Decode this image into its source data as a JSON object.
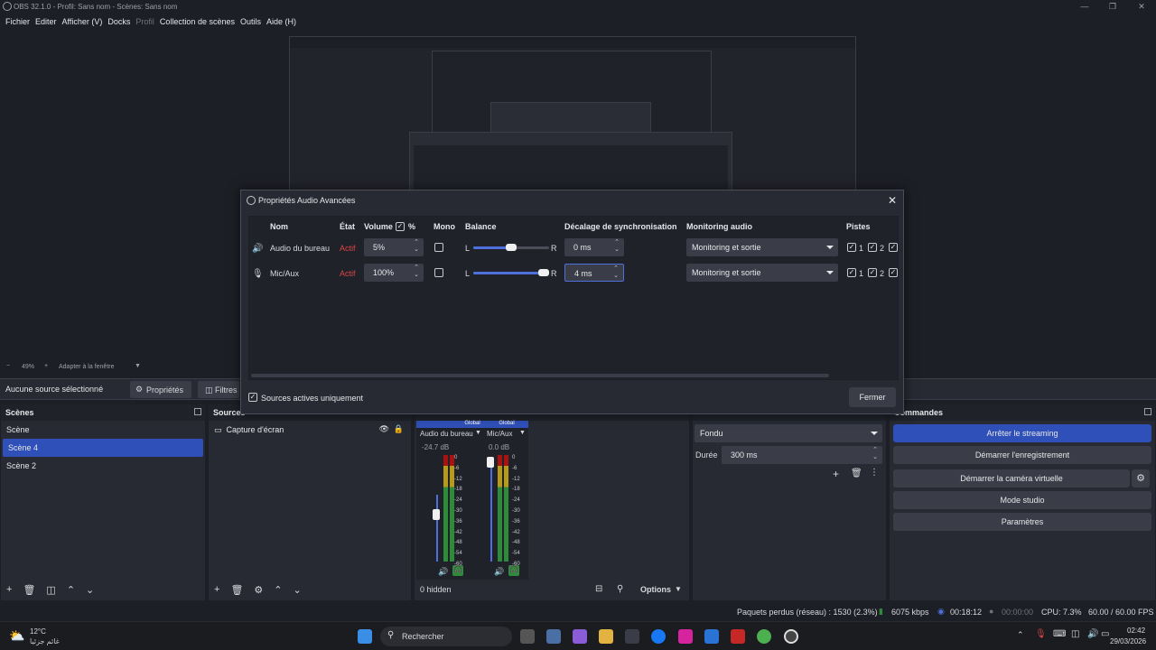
{
  "window": {
    "title": "OBS 32.1.0 - Profil: Sans nom - Scènes: Sans nom"
  },
  "menu": [
    "Fichier",
    "Editer",
    "Afficher (V)",
    "Docks",
    "Profil",
    "Collection de scènes",
    "Outils",
    "Aide (H)"
  ],
  "preview": {
    "zoom": "49%",
    "fit_label": "Adapter à la fenêtre"
  },
  "source_bar": {
    "no_source": "Aucune source sélectionné",
    "properties": "Propriétés",
    "filters": "Filtres"
  },
  "dialog": {
    "title": "Propriétés Audio Avancées",
    "headers": {
      "name": "Nom",
      "status": "État",
      "volume": "Volume",
      "percent": "%",
      "mono": "Mono",
      "balance": "Balance",
      "sync": "Décalage de synchronisation",
      "monitoring": "Monitoring audio",
      "tracks": "Pistes"
    },
    "rows": [
      {
        "name": "Audio du bureau",
        "status": "Actif",
        "volume": "5%",
        "balance_l": "L",
        "balance_r": "R",
        "balance_value": 0.5,
        "sync": "0 ms",
        "monitoring": "Monitoring et sortie",
        "track1": "1",
        "track2": "2"
      },
      {
        "name": "Mic/Aux",
        "status": "Actif",
        "volume": "100%",
        "balance_l": "L",
        "balance_r": "R",
        "balance_value": 1.0,
        "sync": "4 ms",
        "monitoring": "Monitoring et sortie",
        "track1": "1",
        "track2": "2"
      }
    ],
    "active_only": "Sources actives uniquement",
    "close": "Fermer"
  },
  "docks": {
    "scenes": {
      "title": "Scènes",
      "items": [
        "Scène",
        "Scène 4",
        "Scène 2"
      ],
      "selected": "Scène 4"
    },
    "sources": {
      "title": "Sources",
      "items": [
        "Capture d'écran"
      ]
    },
    "mixer": {
      "channels": [
        {
          "scope": "Global",
          "name": "Audio du bureau",
          "level": "-24.7 dB"
        },
        {
          "scope": "Global",
          "name": "Mic/Aux",
          "level": "0.0 dB"
        }
      ],
      "scale": [
        "0",
        "-6",
        "-12",
        "-18",
        "-24",
        "-30",
        "-36",
        "-42",
        "-48",
        "-54",
        "-60"
      ],
      "hidden": "0 hidden",
      "options": "Options"
    },
    "transitions": {
      "transition": "Fondu",
      "duration_label": "Durée",
      "duration": "300 ms"
    },
    "controls": {
      "title": "Commandes",
      "buttons": [
        "Arrêter le streaming",
        "Démarrer l'enregistrement",
        "Démarrer la caméra virtuelle",
        "Mode studio",
        "Paramètres"
      ]
    }
  },
  "status": {
    "dropped": "Paquets perdus (réseau) : 1530 (2.3%)",
    "bitrate": "6075 kbps",
    "stream_time": "00:18:12",
    "rec_time": "00:00:00",
    "cpu": "CPU: 7.3%",
    "fps": "60.00 / 60.00 FPS"
  },
  "taskbar": {
    "temp": "12°C",
    "weather": "غائم جزئيا",
    "search": "Rechercher",
    "time": "02:42",
    "date": "29/03/2026"
  },
  "colors": {
    "accent": "#2f50b8",
    "active": "#d44444",
    "bg": "#1d1f26",
    "panel": "#272a33"
  }
}
